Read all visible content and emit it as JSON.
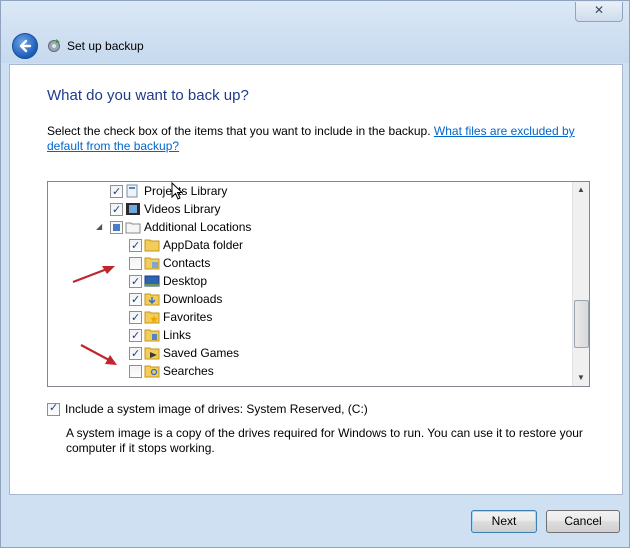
{
  "window": {
    "title": "Set up backup",
    "close_label": "✕"
  },
  "page": {
    "heading": "What do you want to back up?",
    "instruction": "Select the check box of the items that you want to include in the backup.",
    "help_link": "What files are excluded by default from the backup?"
  },
  "tree": {
    "items": [
      {
        "label": "Projects Library",
        "checked": true,
        "icon": "library-icon"
      },
      {
        "label": "Videos Library",
        "checked": true,
        "icon": "video-library-icon"
      },
      {
        "label": "Additional Locations",
        "checked": "partial",
        "icon": "folder-icon"
      },
      {
        "label": "AppData folder",
        "checked": true,
        "icon": "folder-icon"
      },
      {
        "label": "Contacts",
        "checked": false,
        "icon": "contacts-icon"
      },
      {
        "label": "Desktop",
        "checked": true,
        "icon": "desktop-icon"
      },
      {
        "label": "Downloads",
        "checked": true,
        "icon": "downloads-icon"
      },
      {
        "label": "Favorites",
        "checked": true,
        "icon": "favorites-icon"
      },
      {
        "label": "Links",
        "checked": true,
        "icon": "links-icon"
      },
      {
        "label": "Saved Games",
        "checked": true,
        "icon": "saved-games-icon"
      },
      {
        "label": "Searches",
        "checked": false,
        "icon": "searches-icon"
      }
    ]
  },
  "system_image": {
    "checked": true,
    "label": "Include a system image of drives: System Reserved, (C:)",
    "description": "A system image is a copy of the drives required for Windows to run. You can use it to restore your computer if it stops working."
  },
  "buttons": {
    "next": "Next",
    "cancel": "Cancel"
  },
  "colors": {
    "heading": "#1e3c8c",
    "link": "#0066cc",
    "annotation_arrow": "#c0262d"
  }
}
